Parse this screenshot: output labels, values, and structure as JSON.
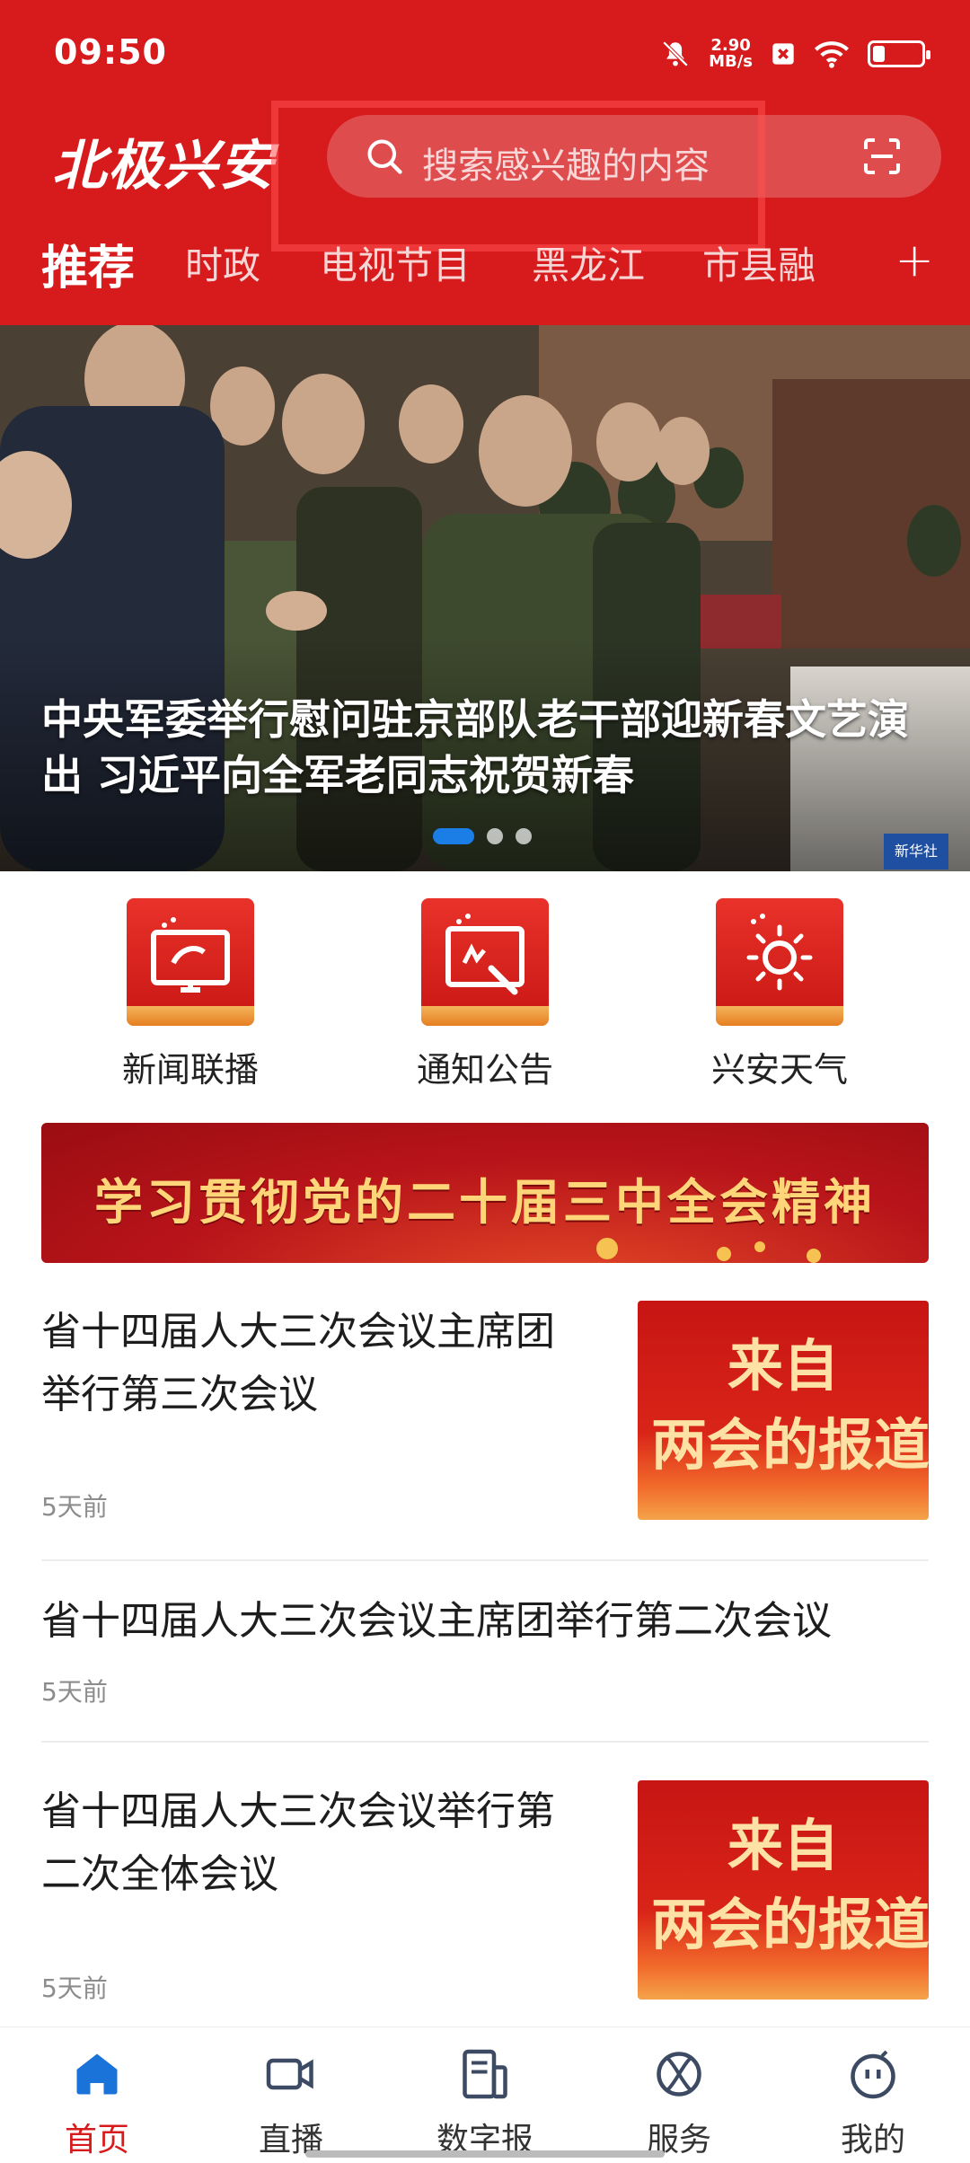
{
  "status_bar": {
    "time": "09:50",
    "net_speed_value": "2.90",
    "net_speed_unit": "MB/s",
    "battery_level": 0.25
  },
  "header": {
    "logo_text": "北极兴安",
    "search_placeholder": "搜索感兴趣的内容",
    "tabs": [
      {
        "label": "推荐",
        "active": true
      },
      {
        "label": "时政",
        "active": false
      },
      {
        "label": "电视节目",
        "active": false
      },
      {
        "label": "黑龙江",
        "active": false
      },
      {
        "label": "市县融",
        "active": false
      }
    ],
    "add_label": "+"
  },
  "hero": {
    "title": "中央军委举行慰问驻京部队老干部迎新春文艺演出 习近平向全军老同志祝贺新春",
    "watermark": "新华社",
    "slide_count": 3,
    "active_slide": 1
  },
  "quick_links": [
    {
      "label": "新闻联播",
      "icon": "tv-icon"
    },
    {
      "label": "通知公告",
      "icon": "notice-board-icon"
    },
    {
      "label": "兴安天气",
      "icon": "sun-icon"
    }
  ],
  "banner": {
    "text": "学习贯彻党的二十届三中全会精神"
  },
  "news": [
    {
      "title": "省十四届人大三次会议主席团举行第三次会议",
      "time": "5天前",
      "thumb_line1": "来自",
      "thumb_line2": "两会的报道"
    },
    {
      "title": "省十四届人大三次会议主席团举行第二次会议",
      "time": "5天前"
    },
    {
      "title": "省十四届人大三次会议举行第二次全体会议",
      "time": "5天前",
      "thumb_line1": "来自",
      "thumb_line2": "两会的报道"
    }
  ],
  "bottom_nav": [
    {
      "label": "首页",
      "icon": "home-icon",
      "active": true
    },
    {
      "label": "直播",
      "icon": "video-camera-icon",
      "active": false
    },
    {
      "label": "数字报",
      "icon": "newspaper-icon",
      "active": false
    },
    {
      "label": "服务",
      "icon": "service-icon",
      "active": false
    },
    {
      "label": "我的",
      "icon": "profile-face-icon",
      "active": false
    }
  ],
  "colors": {
    "brand_red": "#d71a1b",
    "active_dot": "#1a7ee6",
    "banner_text": "#ffd57a"
  }
}
